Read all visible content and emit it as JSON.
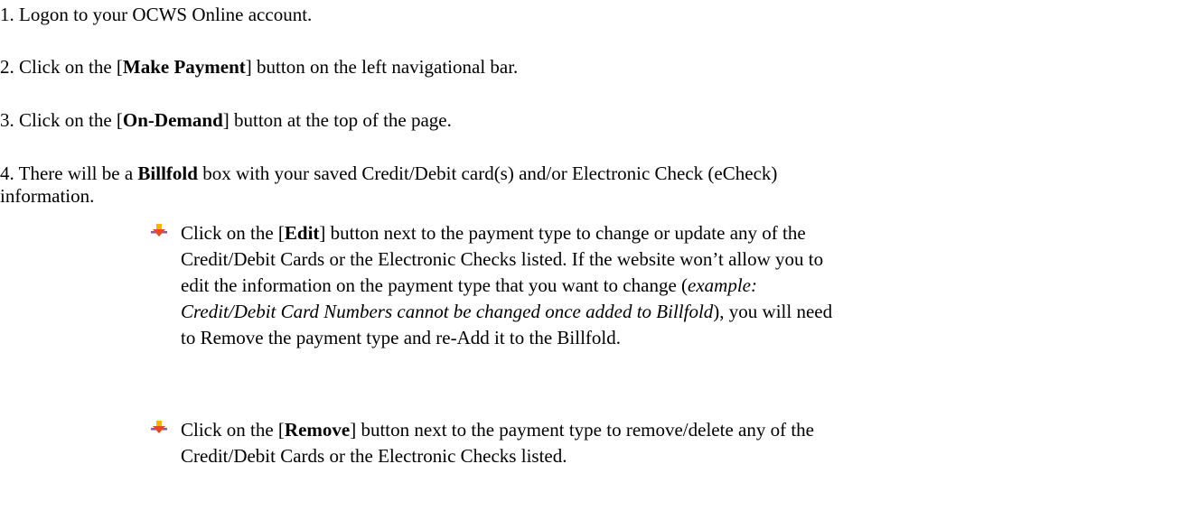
{
  "steps": {
    "s1": "1. Logon to your OCWS Online account.",
    "s2": {
      "pre": "2. Click on the [",
      "bold": "Make Payment",
      "post": "] button on the left navigational bar."
    },
    "s3": {
      "pre": "3. Click on the [",
      "bold": "On-Demand",
      "post": "] button at the top of the page."
    },
    "s4": {
      "pre": "4. There will be a ",
      "bold": "Billfold",
      "line1_post": " box with your saved Credit/Debit card(s) and/or Electronic Check (eCheck)",
      "line2": "information."
    }
  },
  "bullets": {
    "edit": {
      "icon": "arrow-down-bullet-icon",
      "l1_pre": "Click on the [",
      "l1_bold": "Edit",
      "l1_post": "] button next to the payment type to change or update any of the",
      "l2": "Credit/Debit Cards or the Electronic Checks listed.  If the website won’t allow you to",
      "l3_pre": "edit the information on the payment type that you want to change (",
      "l3_italic": "example:",
      "l4_italic": "Credit/Debit Card Numbers cannot be changed once added to Billfold",
      "l4_post": "), you will need",
      "l5": "to Remove the payment type and re-Add it to the Billfold."
    },
    "remove": {
      "icon": "arrow-down-bullet-icon",
      "l1_pre": "Click on the [",
      "l1_bold": "Remove",
      "l1_post": "] button next to the payment type to remove/delete any of the",
      "l2": "Credit/Debit Cards or the Electronic Checks listed."
    }
  },
  "colors": {
    "bullet_arrow_top": "#f2c200",
    "bullet_arrow_bottom": "#e34a2a",
    "bullet_bar": "#8a5a9e"
  }
}
